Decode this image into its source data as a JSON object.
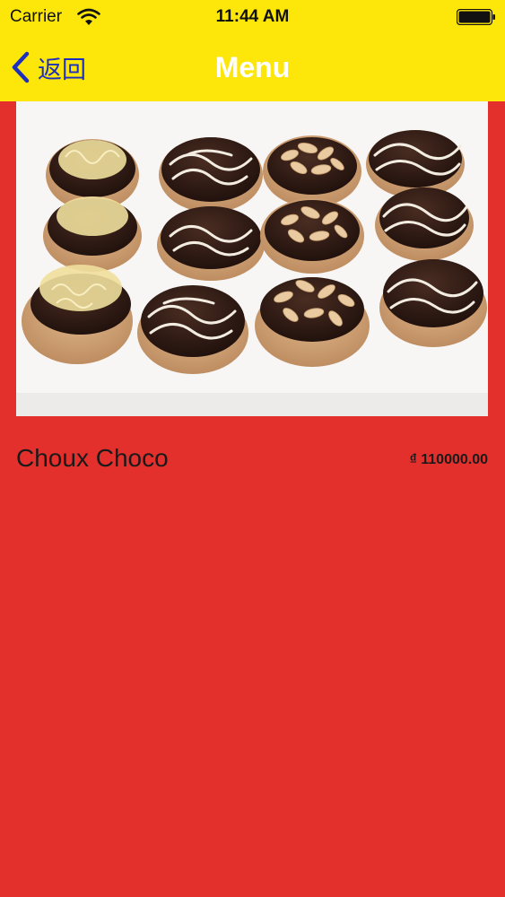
{
  "status_bar": {
    "carrier": "Carrier",
    "time": "11:44 AM",
    "wifi_icon": "wifi-icon",
    "battery_icon": "battery-icon"
  },
  "nav_bar": {
    "back_label": "返回",
    "back_icon": "chevron-left-icon",
    "title": "Menu"
  },
  "product": {
    "name": "Choux Choco",
    "price": "₫ 110000.00",
    "image": "photo of chocolate choux pastries with cheese, almond and white chocolate toppings"
  },
  "colors": {
    "header_background": "#fde60a",
    "page_background": "#e3302d",
    "back_tint": "#1d2fbf",
    "title_color": "#ffffff"
  }
}
